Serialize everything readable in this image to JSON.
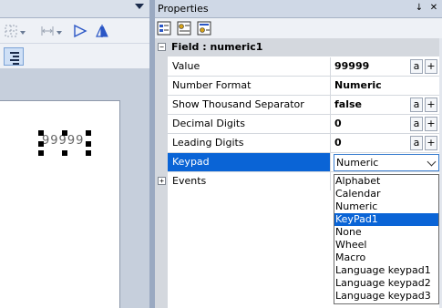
{
  "properties_panel": {
    "title": "Properties",
    "pin_glyph": "↓",
    "close_glyph": "✕",
    "category": {
      "label": "Field : numeric1",
      "expander": "−"
    },
    "rows": [
      {
        "name": "Value",
        "value": "99999",
        "has_buttons": true
      },
      {
        "name": "Number Format",
        "value": "Numeric",
        "has_buttons": false
      },
      {
        "name": "Show Thousand Separator",
        "value": "false",
        "has_buttons": true
      },
      {
        "name": "Decimal Digits",
        "value": "0",
        "has_buttons": true
      },
      {
        "name": "Leading Digits",
        "value": "0",
        "has_buttons": true
      }
    ],
    "buttons": {
      "a": "a",
      "plus": "+"
    },
    "keypad": {
      "name": "Keypad",
      "selected_value": "Numeric"
    },
    "events": {
      "name": "Events",
      "expander": "+"
    }
  },
  "keypad_options": [
    {
      "label": "Alphabet",
      "selected": false
    },
    {
      "label": "Calendar",
      "selected": false
    },
    {
      "label": "Numeric",
      "selected": false
    },
    {
      "label": "KeyPad1",
      "selected": true
    },
    {
      "label": "None",
      "selected": false
    },
    {
      "label": "Wheel",
      "selected": false
    },
    {
      "label": "Macro",
      "selected": false
    },
    {
      "label": "Language keypad1",
      "selected": false
    },
    {
      "label": "Language keypad2",
      "selected": false
    },
    {
      "label": "Language keypad3",
      "selected": false
    }
  ],
  "canvas": {
    "widget_text": "99999"
  },
  "icons": {
    "left_toolbar": [
      "grid-snap-icon",
      "spacing-icon",
      "flip-horizontal-icon",
      "flip-vertical-icon"
    ],
    "align_button": "align-right-icon",
    "props_toolbar": [
      "sort-categorized-icon",
      "sort-alphabetical-icon",
      "property-pages-icon"
    ]
  },
  "colors": {
    "selection": "#0a64d6",
    "accent_icon": "#2a56c6"
  }
}
